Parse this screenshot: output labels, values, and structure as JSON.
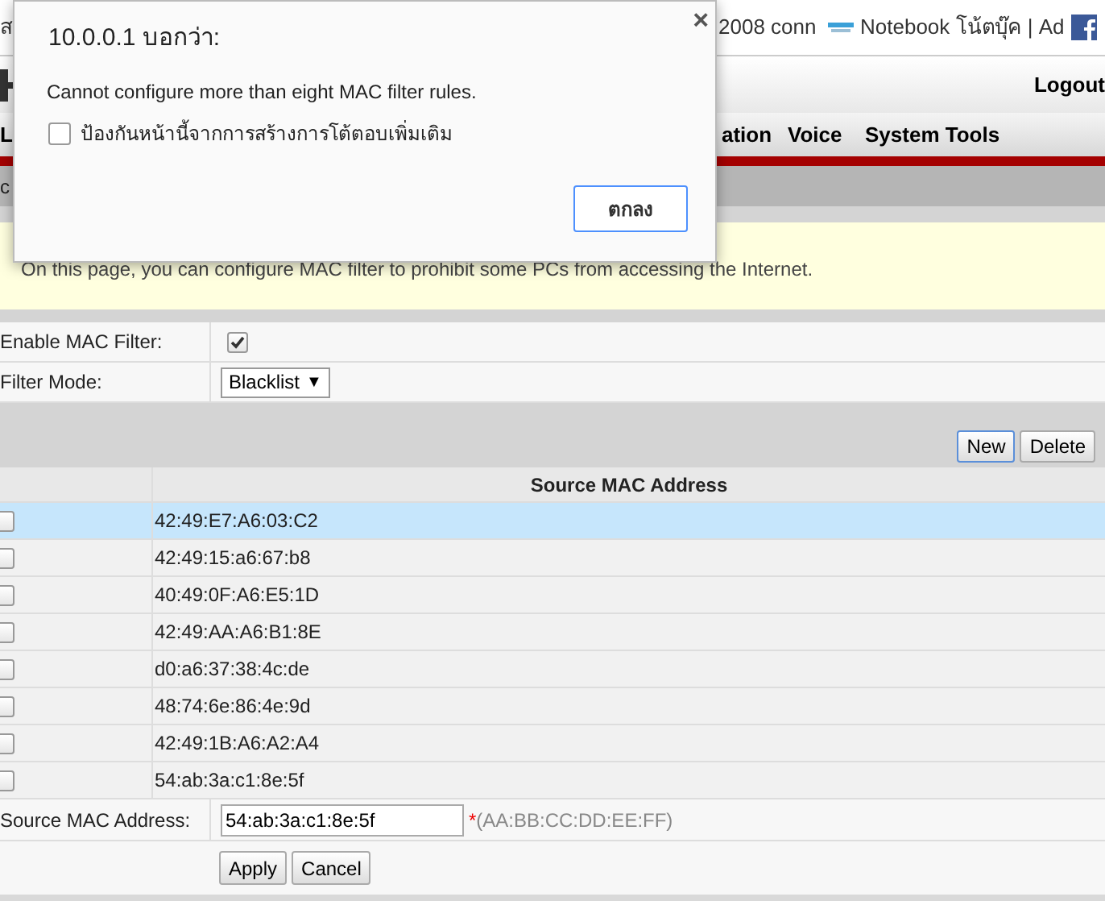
{
  "bookmarks": [
    {
      "label": "ส",
      "kind": "text"
    },
    {
      "label": "2008 conn",
      "kind": "text"
    },
    {
      "label": "Notebook โน้ตบุ๊ค | Ad",
      "kind": "favicon"
    }
  ],
  "header": {
    "logout": "Logout"
  },
  "nav": [
    "L",
    "ation",
    "Voice",
    "System Tools"
  ],
  "subnav": "c",
  "info": "On this page, you can configure MAC filter to prohibit some PCs from accessing the Internet.",
  "form": {
    "enable": {
      "label": "Enable MAC Filter:",
      "checked": true
    },
    "mode": {
      "label": "Filter Mode:",
      "value": "Blacklist",
      "arrow": "▼"
    }
  },
  "toolbar": [
    {
      "label": "New",
      "focused": true
    },
    {
      "label": "Delete",
      "focused": false
    }
  ],
  "table": {
    "columns": [
      "Source MAC Address"
    ],
    "rows": [
      {
        "checked": false,
        "selected": true,
        "mac": "42:49:E7:A6:03:C2"
      },
      {
        "checked": false,
        "selected": false,
        "mac": "42:49:15:a6:67:b8"
      },
      {
        "checked": false,
        "selected": false,
        "mac": "40:49:0F:A6:E5:1D"
      },
      {
        "checked": false,
        "selected": false,
        "mac": "42:49:AA:A6:B1:8E"
      },
      {
        "checked": false,
        "selected": false,
        "mac": "d0:a6:37:38:4c:de"
      },
      {
        "checked": false,
        "selected": false,
        "mac": "48:74:6e:86:4e:9d"
      },
      {
        "checked": false,
        "selected": false,
        "mac": "42:49:1B:A6:A2:A4"
      },
      {
        "checked": false,
        "selected": false,
        "mac": "54:ab:3a:c1:8e:5f"
      }
    ]
  },
  "edit": {
    "label": "Source MAC Address:",
    "value": "54:ab:3a:c1:8e:5f",
    "required": "*",
    "hint": "(AA:BB:CC:DD:EE:FF)"
  },
  "actions": [
    "Apply",
    "Cancel"
  ],
  "dialog": {
    "title": "10.0.0.1 บอกว่า:",
    "close": "×",
    "message": "Cannot configure more than eight MAC filter rules.",
    "checkbox": {
      "label": "ป้องกันหน้านี้จากการสร้างการโต้ตอบเพิ่มเติม",
      "checked": false
    },
    "ok": "ตกลง"
  }
}
